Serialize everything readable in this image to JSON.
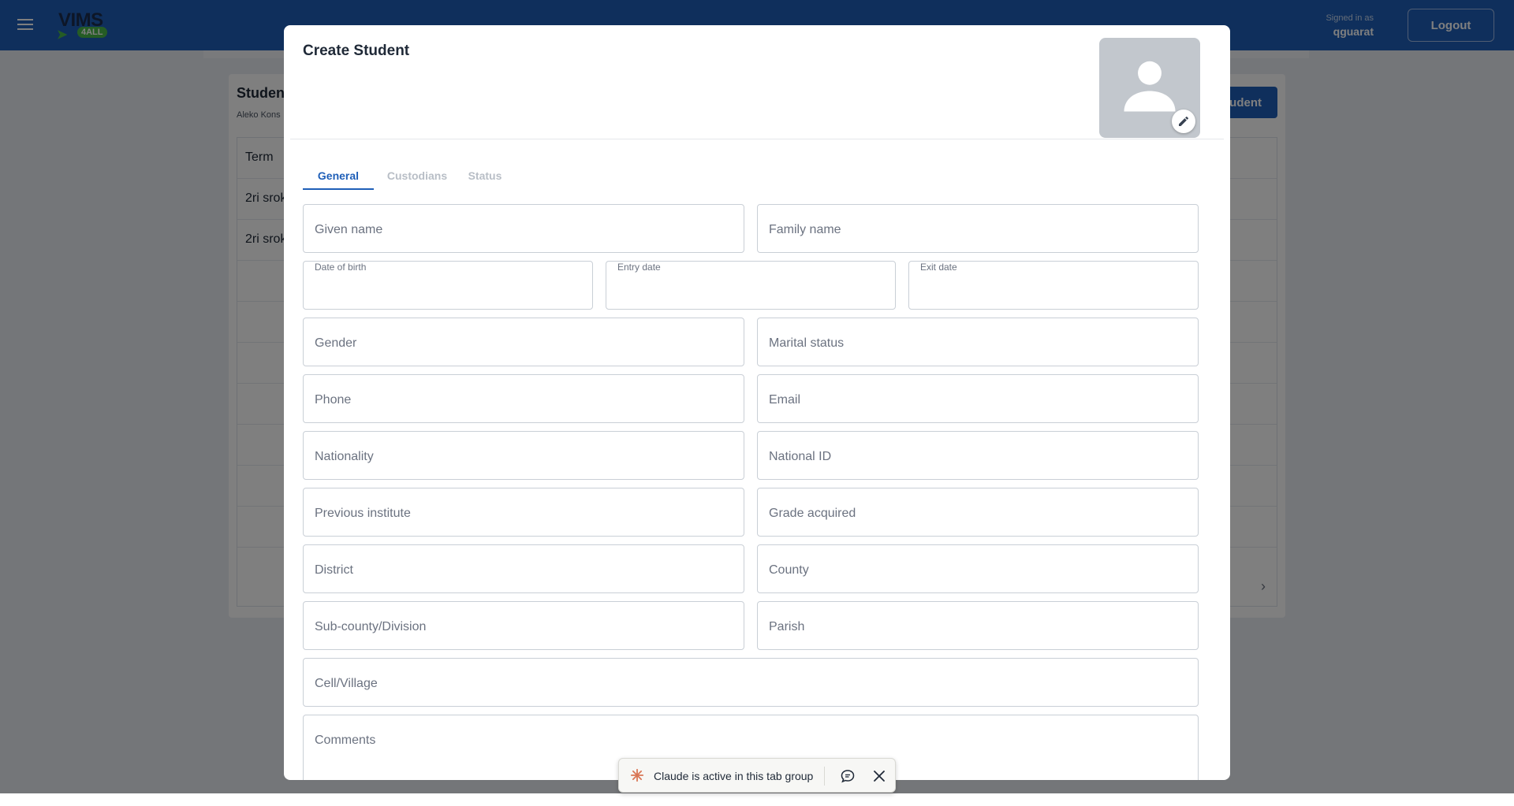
{
  "appbar": {
    "logo_text": "VIMS",
    "logo_badge": "4ALL",
    "signed_in_label": "Signed in as",
    "username": "qguarat",
    "logout_label": "Logout"
  },
  "background": {
    "title": "Studen",
    "subtitle": "Aleko Kons",
    "add_button": "udent",
    "table_header": "Term",
    "rows": [
      "2ri srok",
      "2ri srok"
    ]
  },
  "dialog": {
    "title": "Create Student",
    "tabs": [
      {
        "label": "General",
        "active": true
      },
      {
        "label": "Custodians",
        "active": false
      },
      {
        "label": "Status",
        "active": false
      }
    ],
    "fields": {
      "given_name": "Given name",
      "family_name": "Family name",
      "date_of_birth": "Date of birth",
      "entry_date": "Entry date",
      "exit_date": "Exit date",
      "gender": "Gender",
      "marital_status": "Marital status",
      "phone": "Phone",
      "email": "Email",
      "nationality": "Nationality",
      "national_id": "National ID",
      "previous_institute": "Previous institute",
      "grade_acquired": "Grade acquired",
      "district": "District",
      "county": "County",
      "sub_county": "Sub-county/Division",
      "parish": "Parish",
      "cell_village": "Cell/Village",
      "comments": "Comments"
    }
  },
  "claude_bar": {
    "text": "Claude is active in this tab group"
  },
  "colors": {
    "primary": "#1f5fb8",
    "accent_green": "#4ab84a",
    "claude_orange": "#d97757"
  }
}
